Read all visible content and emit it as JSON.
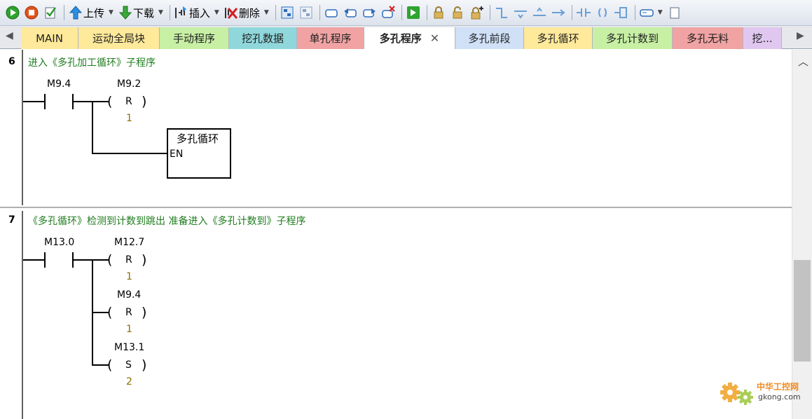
{
  "toolbar": {
    "run_icon": "green-run-icon",
    "stop_icon": "red-stop-icon",
    "compile_icon": "check-compile-icon",
    "upload_label": "上传",
    "download_label": "下载",
    "insert_label": "插入",
    "delete_label": "删除"
  },
  "tabs": [
    {
      "label": "MAIN",
      "color": "#ffe99a"
    },
    {
      "label": "运动全局块",
      "color": "#ffe99a"
    },
    {
      "label": "手动程序",
      "color": "#c7f0a4"
    },
    {
      "label": "挖孔数据",
      "color": "#8fd7db"
    },
    {
      "label": "单孔程序",
      "color": "#f1a3a3"
    },
    {
      "label": "多孔程序",
      "color": "#ffffff"
    },
    {
      "label": "多孔前段",
      "color": "#cfe0f7"
    },
    {
      "label": "多孔循环",
      "color": "#ffe99a"
    },
    {
      "label": "多孔计数到",
      "color": "#c7f0a4"
    },
    {
      "label": "多孔无料",
      "color": "#f1a3a3"
    },
    {
      "label": "挖...",
      "color": "#e0c7f0"
    }
  ],
  "networks": [
    {
      "number": "6",
      "title": "进入《多孔加工循环》子程序",
      "contact": "M9.4",
      "coils": [
        {
          "operand": "M9.2",
          "type": "R",
          "n": "1"
        }
      ],
      "box": {
        "title": "多孔循环",
        "pin": "EN"
      }
    },
    {
      "number": "7",
      "title": "《多孔循环》检测到计数到跳出  准备进入《多孔计数到》子程序",
      "contact": "M13.0",
      "coils": [
        {
          "operand": "M12.7",
          "type": "R",
          "n": "1"
        },
        {
          "operand": "M9.4",
          "type": "R",
          "n": "1"
        },
        {
          "operand": "M13.1",
          "type": "S",
          "n": "2"
        }
      ]
    }
  ],
  "watermark": {
    "title": "中华工控网",
    "url": "gkong.com"
  }
}
